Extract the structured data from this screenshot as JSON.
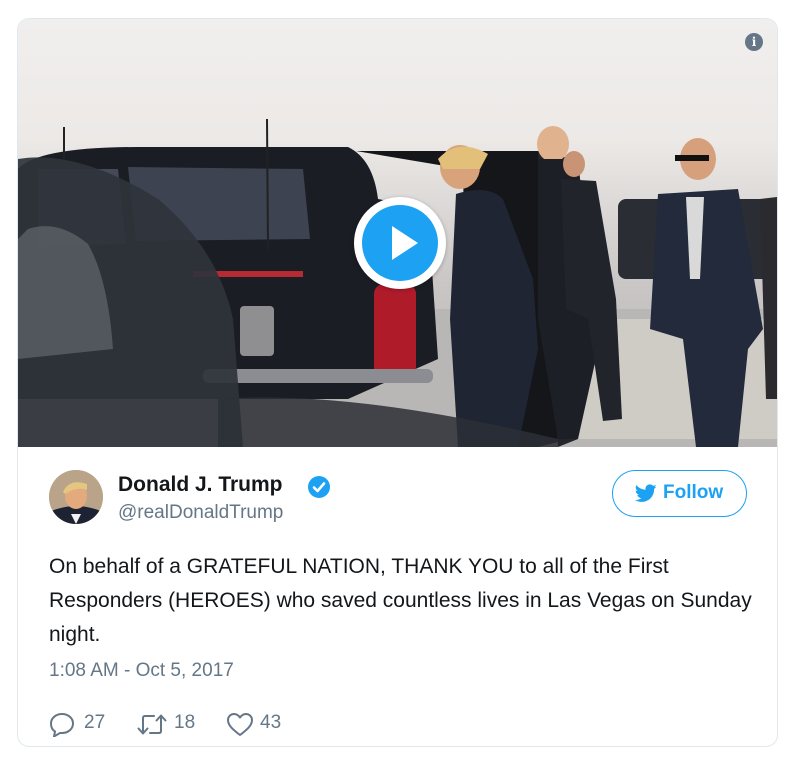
{
  "tweet": {
    "author": {
      "name": "Donald J. Trump",
      "handle": "@realDonaldTrump",
      "verified": true
    },
    "follow_label": "Follow",
    "text": "On behalf of a GRATEFUL NATION, THANK YOU to all of the First Responders (HEROES) who saved countless lives in Las Vegas on Sunday night.",
    "timestamp": "1:08 AM - Oct 5, 2017",
    "stats": {
      "replies": "27",
      "retweets": "18",
      "likes": "43"
    }
  },
  "media": {
    "info_symbol": "i",
    "icons": [
      "info-icon",
      "play-icon"
    ]
  },
  "colors": {
    "accent": "#1da1f2",
    "secondary_text": "#657786",
    "primary_text": "#14171a",
    "border": "#e1e8ed"
  }
}
